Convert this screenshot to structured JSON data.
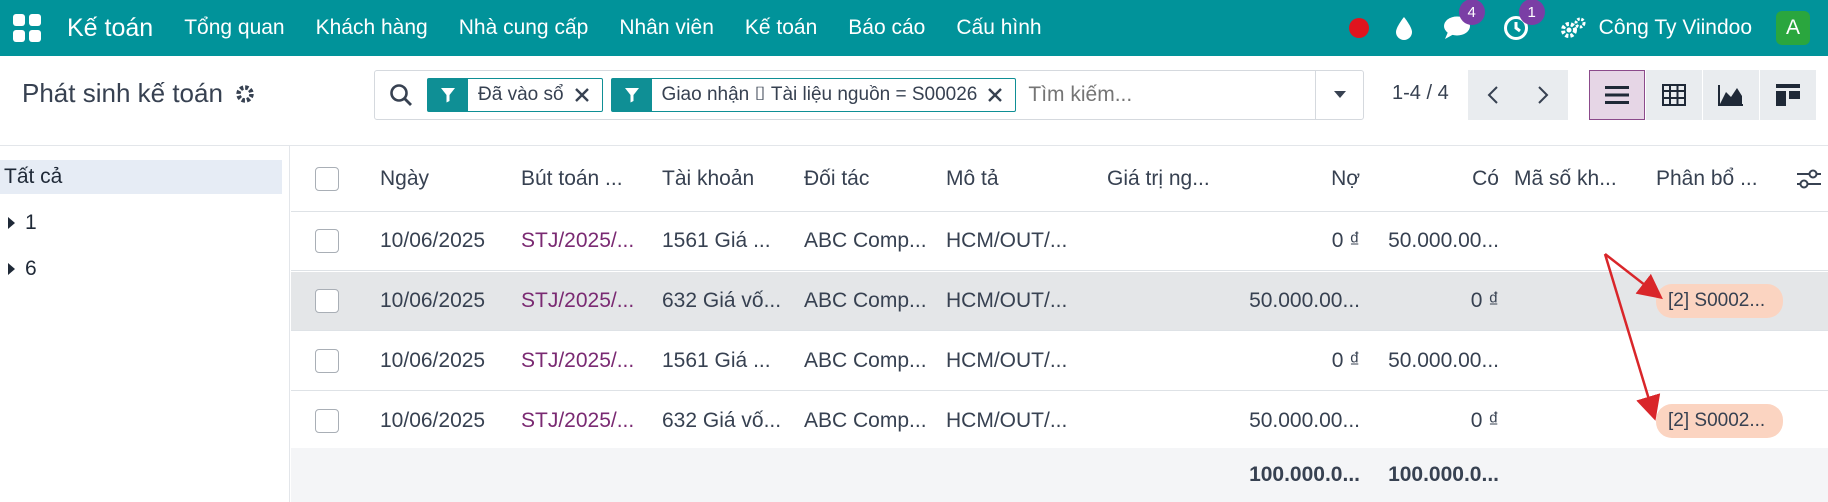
{
  "navbar": {
    "brand": "Kế toán",
    "menu": [
      "Tổng quan",
      "Khách hàng",
      "Nhà cung cấp",
      "Nhân viên",
      "Kế toán",
      "Báo cáo",
      "Cấu hình"
    ],
    "messages_badge": "4",
    "activity_badge": "1",
    "company": "Công Ty Viindoo",
    "avatar_letter": "A"
  },
  "control": {
    "title": "Phát sinh kế toán",
    "facets": [
      "Đã vào sổ",
      "Giao nhận ⌷ Tài liệu nguồn = S00026"
    ],
    "search_placeholder": "Tìm kiếm...",
    "pager": "1-4 / 4"
  },
  "sidebar": {
    "all_label": "Tất cả",
    "items": [
      "1",
      "6"
    ]
  },
  "table": {
    "headers": [
      "Ngày",
      "Bút toán ...",
      "Tài khoản",
      "Đối tác",
      "Mô tả",
      "Giá trị ng...",
      "Nợ",
      "Có",
      "Mã số kh...",
      "Phân bổ ..."
    ],
    "rows": [
      {
        "date": "10/06/2025",
        "entry": "STJ/2025/...",
        "account": "1561 Giá ...",
        "partner": "ABC Comp...",
        "desc": "HCM/OUT/...",
        "debit": "0 ₫",
        "credit": "50.000.00...",
        "tag": ""
      },
      {
        "date": "10/06/2025",
        "entry": "STJ/2025/...",
        "account": "632 Giá vố...",
        "partner": "ABC Comp...",
        "desc": "HCM/OUT/...",
        "debit": "50.000.00...",
        "credit": "0 ₫",
        "tag": "[2] S0002..."
      },
      {
        "date": "10/06/2025",
        "entry": "STJ/2025/...",
        "account": "1561 Giá ...",
        "partner": "ABC Comp...",
        "desc": "HCM/OUT/...",
        "debit": "0 ₫",
        "credit": "50.000.00...",
        "tag": ""
      },
      {
        "date": "10/06/2025",
        "entry": "STJ/2025/...",
        "account": "632 Giá vố...",
        "partner": "ABC Comp...",
        "desc": "HCM/OUT/...",
        "debit": "50.000.00...",
        "credit": "0 ₫",
        "tag": "[2] S0002..."
      }
    ],
    "totals": {
      "debit": "100.000.0...",
      "credit": "100.000.0..."
    }
  },
  "colors": {
    "navbar": "#01939a",
    "accent": "#7a2a72",
    "annotation": "#d9262a"
  }
}
